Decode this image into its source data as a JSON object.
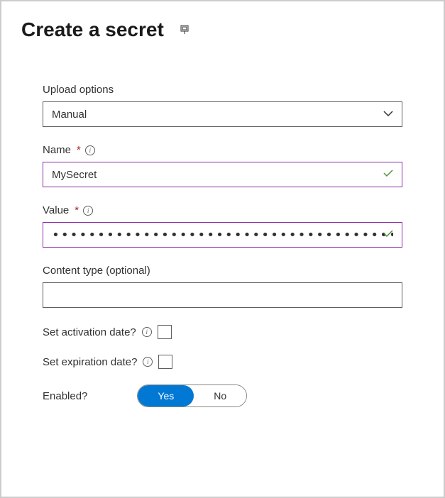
{
  "header": {
    "title": "Create a secret"
  },
  "form": {
    "upload_options": {
      "label": "Upload options",
      "value": "Manual"
    },
    "name": {
      "label": "Name",
      "required_mark": "*",
      "value": "MySecret"
    },
    "value": {
      "label": "Value",
      "required_mark": "*",
      "masked": "•••••••••••••••••••••••••••••••••••••••••"
    },
    "content_type": {
      "label": "Content type (optional)",
      "value": ""
    },
    "activation": {
      "label": "Set activation date?"
    },
    "expiration": {
      "label": "Set expiration date?"
    },
    "enabled": {
      "label": "Enabled?",
      "yes": "Yes",
      "no": "No"
    }
  }
}
